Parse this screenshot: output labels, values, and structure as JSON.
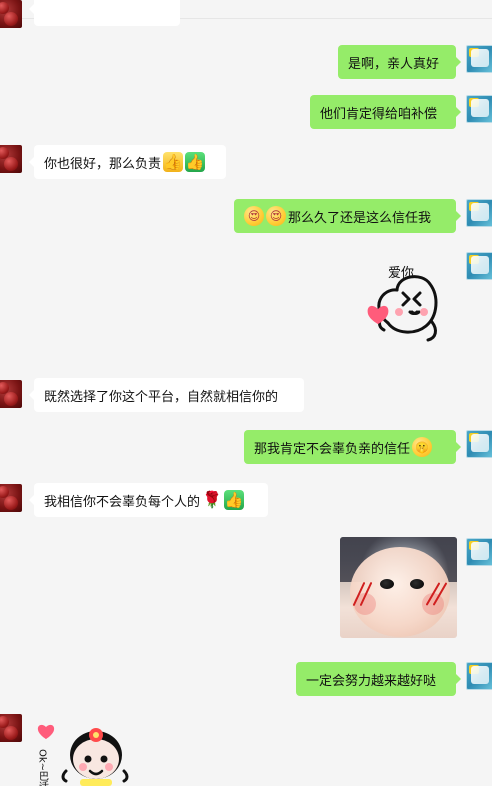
{
  "chat": {
    "messages": [
      {
        "side": "left",
        "text": ""
      },
      {
        "side": "right",
        "text": "是啊，亲人真好"
      },
      {
        "side": "right",
        "text": "他们肯定得给咱补偿"
      },
      {
        "side": "left",
        "text": "你也很好，那么负责"
      },
      {
        "side": "right",
        "text": "那么久了还是这么信任我"
      },
      {
        "side": "right",
        "sticker_text": "爱你"
      },
      {
        "side": "left",
        "text": "既然选择了你这个平台，自然就相信你的"
      },
      {
        "side": "right",
        "text": "那我肯定不会辜负亲的信任"
      },
      {
        "side": "left",
        "text": "我相信你不会辜负每个人的"
      },
      {
        "side": "right",
        "image": "photo"
      },
      {
        "side": "right",
        "text": "一定会努力越来越好哒"
      },
      {
        "side": "left",
        "sticker_text": "Ok~巴适"
      }
    ]
  },
  "icons": {
    "thumbs_up": "thumbs-up",
    "sticker_love": "love-sticker",
    "rose": "rose",
    "face": "face",
    "photo": "baby-photo"
  },
  "colors": {
    "background": "#f5f5f5",
    "bubble_left": "#ffffff",
    "bubble_right": "#95ec69"
  }
}
